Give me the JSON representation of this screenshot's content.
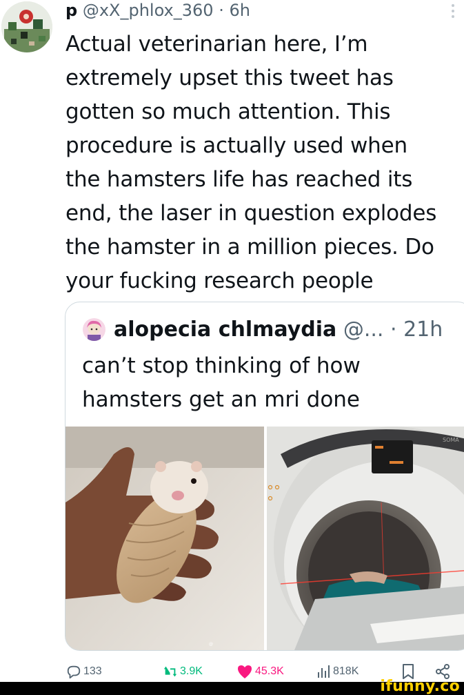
{
  "tweet": {
    "display_name": "p",
    "handle": "@xX_phlox_360",
    "separator": "·",
    "time": "6h",
    "more_icon": "more-vertical-icon",
    "text_lines": [
      "Actual veterinarian here, I’m",
      "extremely upset this tweet has",
      "gotten so much attention. This",
      "procedure is actually used when",
      "the hamsters life has reached its",
      "end, the laser in question explodes",
      "the hamster in a million pieces. Do",
      "your fucking research people"
    ]
  },
  "quote": {
    "display_name": "alopecia chlmaydia",
    "handle": "@...",
    "separator": "·",
    "time": "21h",
    "text_lines": [
      "can’t stop thinking of how",
      "hamsters get an mri done"
    ],
    "scanner_brand": "SOMA"
  },
  "actions": {
    "replies": "133",
    "retweets": "3.9K",
    "likes": "45.3K",
    "views": "818K"
  },
  "colors": {
    "retweet": "#00ba7c",
    "like": "#f91880",
    "muted": "#536471",
    "watermark": "#ffd000"
  },
  "watermark": {
    "text": "ifunny.co"
  }
}
